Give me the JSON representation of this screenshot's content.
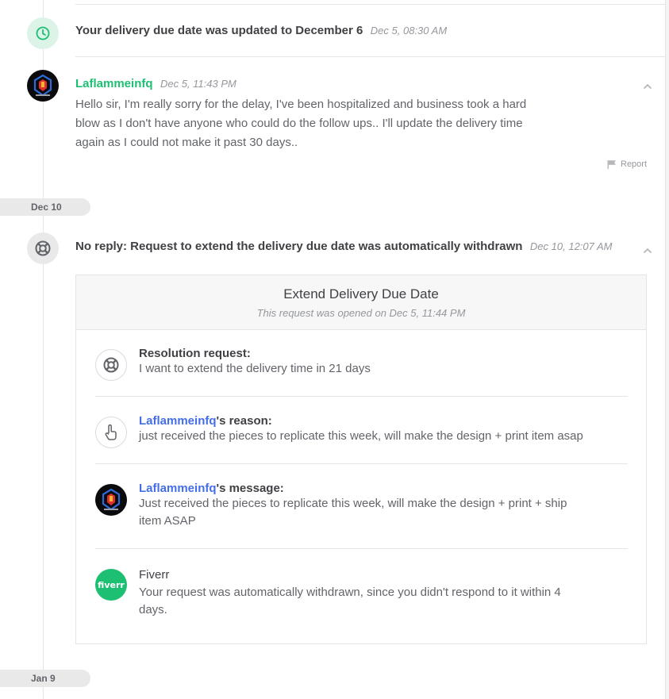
{
  "timeline": {
    "event_due_update": {
      "text": "Your delivery due date was updated to December 6",
      "timestamp": "Dec 5, 08:30 AM"
    },
    "message1": {
      "author": "Laflammeinfq",
      "timestamp": "Dec 5, 11:43 PM",
      "lines": [
        "Hello sir, I'm really sorry for the delay, I've been hospitalized and business took a hard",
        "blow as I don't have anyone who could do the follow ups.. I'll update the delivery time",
        "again as I could not make it past 30 days.."
      ],
      "report_label": "Report"
    },
    "date_dec10": "Dec 10",
    "event_withdrawn": {
      "text": "No reply: Request to extend the delivery due date was automatically withdrawn",
      "timestamp": "Dec 10, 12:07 AM"
    },
    "card": {
      "title": "Extend Delivery Due Date",
      "subtitle": "This request was opened on Dec 5, 11:44 PM",
      "resolution": {
        "label": "Resolution request:",
        "text": "I want to extend the delivery time in 21 days"
      },
      "reason": {
        "user": "Laflammeinfq",
        "label_suffix": "'s reason:",
        "text": "just received the pieces to replicate this week, will make the design + print item asap"
      },
      "message": {
        "user": "Laflammeinfq",
        "label_suffix": "'s message:",
        "lines": [
          "Just received the pieces to replicate this week, will make the design + print + ship",
          "item ASAP"
        ]
      },
      "fiverr": {
        "label": "Fiverr",
        "logo_text": "fiverr",
        "lines": [
          "Your request was automatically withdrawn, since you didn't respond to it within 4",
          "days."
        ]
      }
    },
    "date_jan9": "Jan 9"
  },
  "colors": {
    "brand_green": "#1dbf73",
    "link_blue": "#446ee7"
  },
  "icons": {
    "due_update": "clock-icon",
    "withdrawn": "lifebuoy-icon",
    "collapse": "chevron-up-icon",
    "report": "flag-icon",
    "reason": "hand-pointer-icon"
  }
}
